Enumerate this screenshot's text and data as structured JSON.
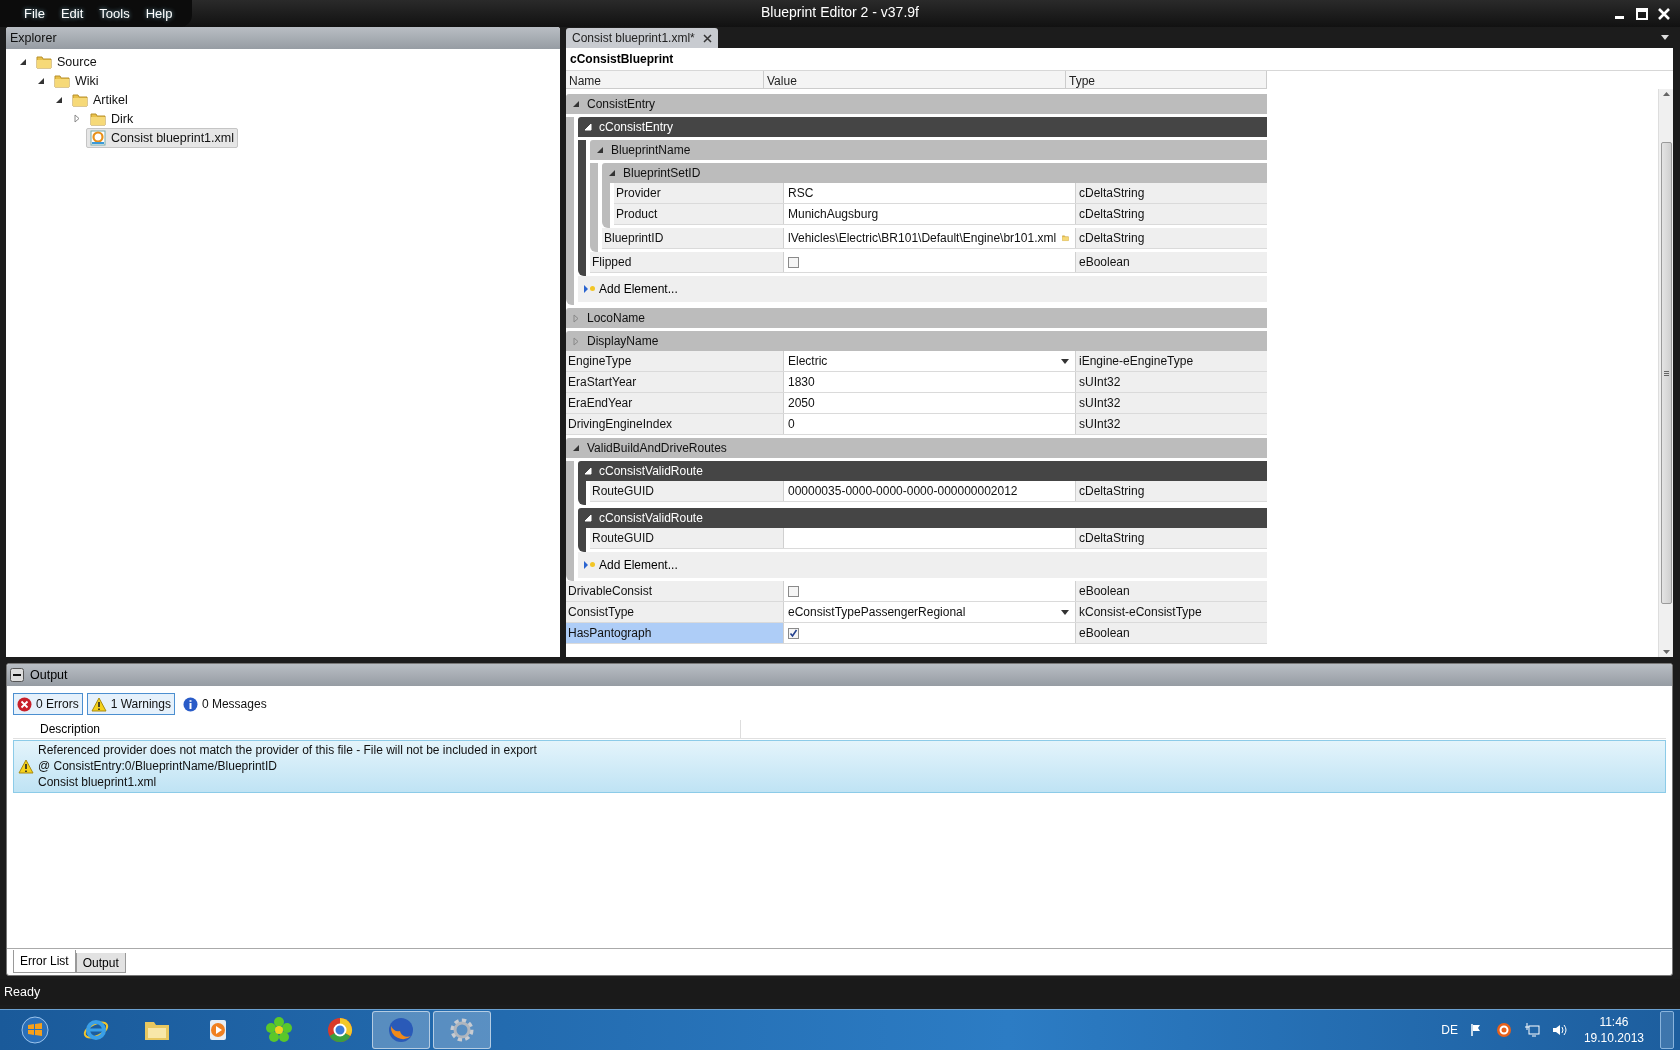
{
  "window": {
    "title": "Blueprint Editor 2 - v37.9f",
    "menu": [
      "File",
      "Edit",
      "Tools",
      "Help"
    ]
  },
  "explorer": {
    "title": "Explorer",
    "tree": [
      {
        "label": "Source",
        "kind": "folder",
        "expanded": true,
        "selected": false,
        "children": [
          {
            "label": "Wiki",
            "kind": "folder",
            "expanded": true,
            "selected": false,
            "children": [
              {
                "label": "Artikel",
                "kind": "folder",
                "expanded": true,
                "selected": false,
                "children": [
                  {
                    "label": "Dirk",
                    "kind": "folder",
                    "expanded": false,
                    "selected": false
                  },
                  {
                    "label": "Consist blueprint1.xml",
                    "kind": "file",
                    "selected": true
                  }
                ]
              }
            ]
          }
        ]
      }
    ]
  },
  "editor": {
    "tabs": [
      {
        "label": "Consist blueprint1.xml*",
        "selected": true
      }
    ],
    "property_grid": {
      "title": "cConsistBlueprint",
      "columns": [
        "Name",
        "Value",
        "Type"
      ],
      "items": [
        {
          "kind": "category",
          "label": "ConsistEntry",
          "expanded": true,
          "children": [
            {
              "kind": "element",
              "label": "cConsistEntry",
              "expanded": true,
              "children": [
                {
                  "kind": "category",
                  "label": "BlueprintName",
                  "expanded": true,
                  "children": [
                    {
                      "kind": "category",
                      "label": "BlueprintSetID",
                      "expanded": true,
                      "children": [
                        {
                          "kind": "text",
                          "name": "Provider",
                          "value": "RSC",
                          "type": "cDeltaString",
                          "selected": false
                        },
                        {
                          "kind": "text",
                          "name": "Product",
                          "value": "MunichAugsburg",
                          "type": "cDeltaString",
                          "selected": false
                        }
                      ]
                    },
                    {
                      "kind": "file",
                      "name": "BlueprintID",
                      "value": "lVehicles\\Electric\\BR101\\Default\\Engine\\br101.xml",
                      "type": "cDeltaString",
                      "selected": false
                    }
                  ]
                },
                {
                  "kind": "checkbox",
                  "name": "Flipped",
                  "checked": false,
                  "type": "eBoolean",
                  "selected": false
                }
              ]
            },
            {
              "kind": "add",
              "label": "Add Element..."
            }
          ]
        },
        {
          "kind": "category",
          "label": "LocoName",
          "expanded": false
        },
        {
          "kind": "category",
          "label": "DisplayName",
          "expanded": false
        },
        {
          "kind": "dropdown",
          "name": "EngineType",
          "value": "Electric",
          "type": "iEngine-eEngineType",
          "selected": false
        },
        {
          "kind": "text",
          "name": "EraStartYear",
          "value": "1830",
          "type": "sUInt32",
          "selected": false
        },
        {
          "kind": "text",
          "name": "EraEndYear",
          "value": "2050",
          "type": "sUInt32",
          "selected": false
        },
        {
          "kind": "text",
          "name": "DrivingEngineIndex",
          "value": "0",
          "type": "sUInt32",
          "selected": false
        },
        {
          "kind": "category",
          "label": "ValidBuildAndDriveRoutes",
          "expanded": true,
          "children": [
            {
              "kind": "element",
              "label": "cConsistValidRoute",
              "expanded": true,
              "children": [
                {
                  "kind": "text",
                  "name": "RouteGUID",
                  "value": "00000035-0000-0000-0000-000000002012",
                  "type": "cDeltaString",
                  "selected": false
                }
              ]
            },
            {
              "kind": "element",
              "label": "cConsistValidRoute",
              "expanded": true,
              "children": [
                {
                  "kind": "text",
                  "name": "RouteGUID",
                  "type": "cDeltaString",
                  "selected": false
                }
              ]
            },
            {
              "kind": "add",
              "label": "Add Element..."
            }
          ]
        },
        {
          "kind": "checkbox",
          "name": "DrivableConsist",
          "checked": false,
          "type": "eBoolean",
          "selected": false
        },
        {
          "kind": "dropdown",
          "name": "ConsistType",
          "value": "eConsistTypePassengerRegional",
          "type": "kConsist-eConsistType",
          "selected": false
        },
        {
          "kind": "checkbox",
          "name": "HasPantograph",
          "checked": true,
          "type": "eBoolean",
          "selected": true
        }
      ]
    }
  },
  "output": {
    "title": "Output",
    "filters": [
      {
        "kind": "error",
        "label": "0 Errors",
        "selected": true
      },
      {
        "kind": "warning",
        "label": "1 Warnings",
        "selected": true
      },
      {
        "kind": "info",
        "label": "0 Messages",
        "selected": false
      }
    ],
    "columns": [
      "Description"
    ],
    "rows": [
      {
        "kind": "warning",
        "message": "Referenced provider does not match the provider of this file - File will not be included in export",
        "location": "@ ConsistEntry:0/BlueprintName/BlueprintID",
        "file": "Consist blueprint1.xml",
        "selected": true
      }
    ],
    "tabs": [
      {
        "label": "Error List",
        "selected": true
      },
      {
        "label": "Output",
        "selected": false
      }
    ]
  },
  "status_bar": {
    "text": "Ready"
  },
  "taskbar": {
    "apps": [
      {
        "kind": "start",
        "active": false
      },
      {
        "kind": "browser",
        "active": false
      },
      {
        "kind": "folder",
        "active": false
      },
      {
        "kind": "player",
        "active": false
      },
      {
        "kind": "flower",
        "active": false
      },
      {
        "kind": "ring",
        "active": false
      },
      {
        "kind": "fox",
        "active": true
      },
      {
        "kind": "gear",
        "active": true
      }
    ],
    "language": "DE",
    "time": "11:46",
    "date": "19.10.2013"
  }
}
